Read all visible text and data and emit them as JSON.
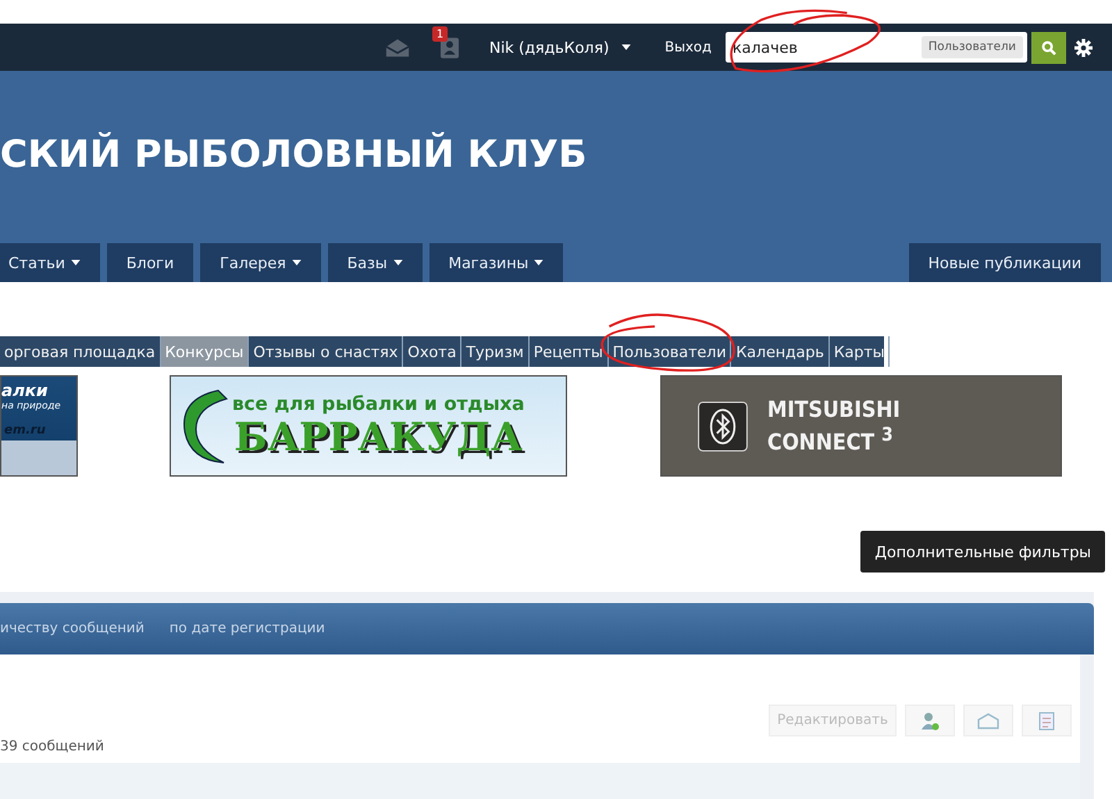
{
  "top_bar": {
    "notifications_badge": "1",
    "user_name": "Nik (дядьКоля)",
    "logout": "Выход",
    "search": {
      "value": "калачев",
      "scope": "Пользователи"
    }
  },
  "site_title": "СКИЙ РЫБОЛОВНЫЙ КЛУБ",
  "main_nav": [
    {
      "label": "Статьи",
      "dropdown": true
    },
    {
      "label": "Блоги",
      "dropdown": false
    },
    {
      "label": "Галерея",
      "dropdown": true
    },
    {
      "label": "Базы",
      "dropdown": true
    },
    {
      "label": "Магазины",
      "dropdown": true
    }
  ],
  "new_posts": "Новые публикации",
  "sub_nav": [
    {
      "label": "орговая площадка",
      "selected": false
    },
    {
      "label": "Конкурсы",
      "selected": true
    },
    {
      "label": "Отзывы о снастях",
      "selected": false
    },
    {
      "label": "Охота",
      "selected": false
    },
    {
      "label": "Туризм",
      "selected": false
    },
    {
      "label": "Рецепты",
      "selected": false
    },
    {
      "label": "Пользователи",
      "selected": false
    },
    {
      "label": "Календарь",
      "selected": false
    },
    {
      "label": "Карты",
      "selected": false
    }
  ],
  "banners": [
    {
      "kind": "left",
      "line_1": "алки",
      "line_2": "на природе",
      "line_3": "em.ru"
    },
    {
      "kind": "barracuda",
      "line_1": "все для рыбалки и отдыха",
      "line_2": "БАРРАКУДА"
    },
    {
      "kind": "mitsubishi",
      "line_1": "MITSUBISHI",
      "line_2": "CONNECT",
      "mark": "3"
    }
  ],
  "filters_button": "Дополнительные фильтры",
  "sort_tabs": [
    "ичеству сообщений",
    "по дате регистрации"
  ],
  "member": {
    "edit_button": "Редактировать",
    "posts": "39 сообщений"
  }
}
